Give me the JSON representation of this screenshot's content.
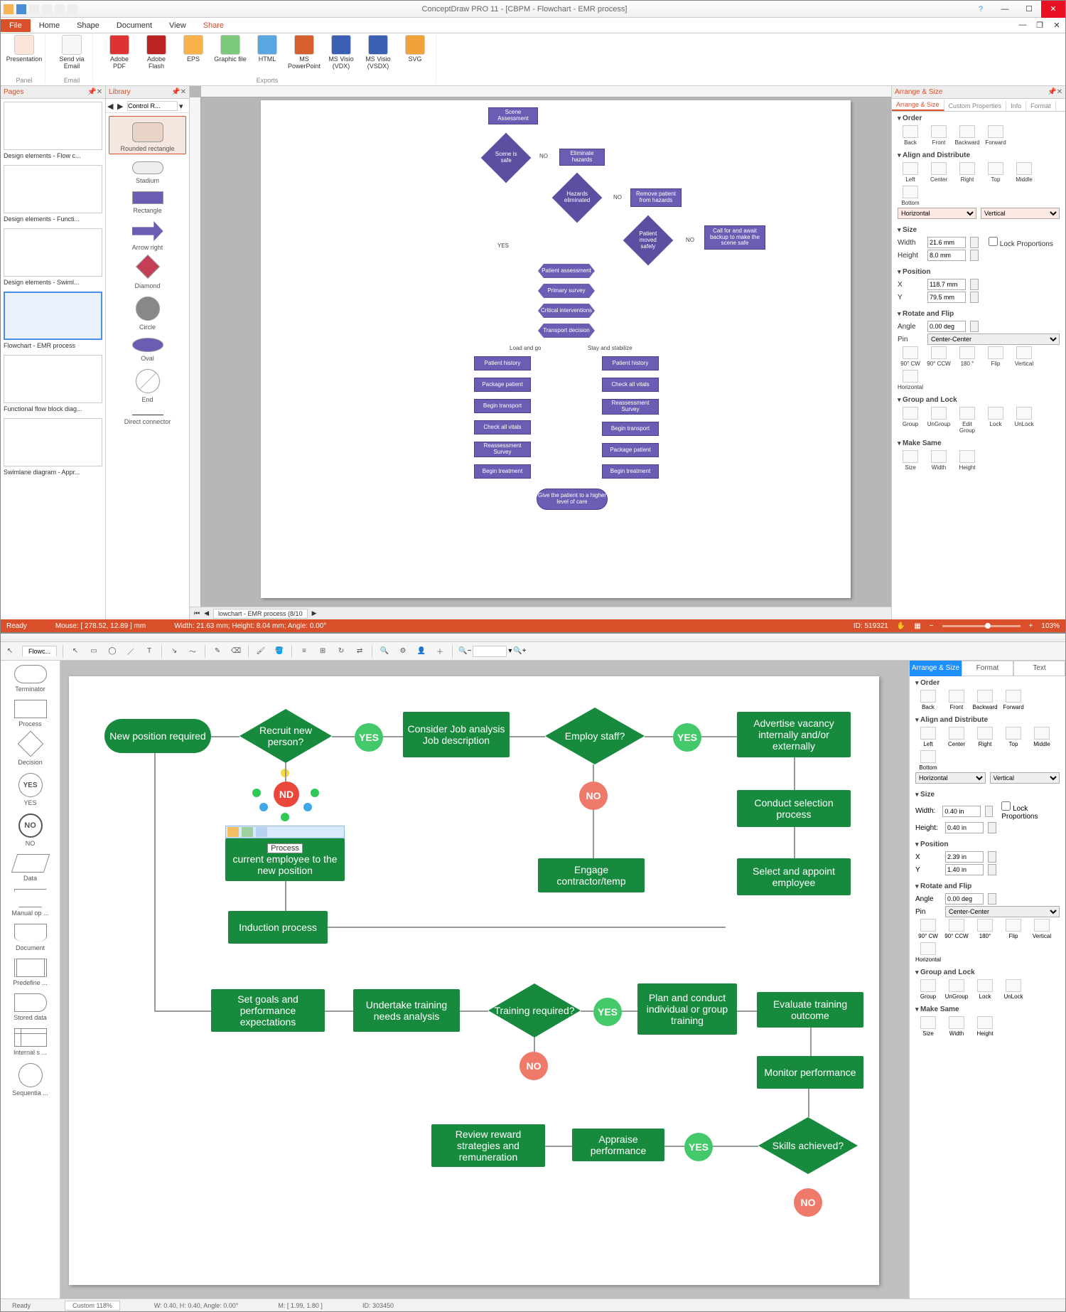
{
  "app1": {
    "title": "ConceptDraw PRO 11 - [CBPM - Flowchart - EMR process]",
    "menu": {
      "file": "File",
      "home": "Home",
      "shape": "Shape",
      "document": "Document",
      "view": "View",
      "share": "Share"
    },
    "ribbon": {
      "presentation": "Presentation",
      "sendEmail": "Send via Email",
      "adobePdf": "Adobe PDF",
      "adobeFlash": "Adobe Flash",
      "eps": "EPS",
      "graphicFile": "Graphic file",
      "html": "HTML",
      "msPpt": "MS PowerPoint",
      "visioVdx": "MS Visio (VDX)",
      "visioVsdx": "MS Visio (VSDX)",
      "svg": "SVG",
      "grpPanel": "Panel",
      "grpEmail": "Email",
      "grpExports": "Exports"
    },
    "panes": {
      "pages": "Pages",
      "library": "Library",
      "arrange": "Arrange & Size"
    },
    "pages": [
      "Design elements - Flow c...",
      "Design elements - Functi...",
      "Design elements - Swiml...",
      "Flowchart - EMR process",
      "Functional flow block diag...",
      "Swimlane diagram - Appr..."
    ],
    "libNav": "Control R...",
    "libShapes": [
      "Rounded rectangle",
      "Stadium",
      "Rectangle",
      "Arrow right",
      "Diamond",
      "Circle",
      "Oval",
      "End",
      "Direct connector"
    ],
    "flow": {
      "sceneAssessment": "Scene Assessment",
      "sceneSafe": "Scene is safe",
      "eliminateHazards": "Eliminate hazards",
      "hazardsEliminated": "Hazards eliminated",
      "removePatient": "Remove patient from hazards",
      "patientMoved": "Patient moved safely",
      "callBackup": "Call for and await backup to make the scene safe",
      "patientAssessment": "Patient assessment",
      "primarySurvey": "Primary survey",
      "criticalIntervention": "Critical interventions",
      "transportDecision": "Transport decision",
      "loadGo": "Load and go",
      "stayStab": "Stay and stabilize",
      "leftCol": [
        "Patient history",
        "Package patient",
        "Begin transport",
        "Check all vitals",
        "Reassessment Survey",
        "Begin treatment"
      ],
      "rightCol": [
        "Patient history",
        "Check all vitals",
        "Reassessment Survey",
        "Begin transport",
        "Package patient",
        "Begin treatment"
      ],
      "final": "Give the patient to a higher level of care",
      "yes": "YES",
      "no": "NO"
    },
    "tabstrip": "lowchart - EMR process (8/10",
    "rpanel": {
      "tabs": [
        "Arrange & Size",
        "Custom Properties",
        "Info",
        "Format"
      ],
      "order": "Order",
      "orderBtns": [
        "Back",
        "Front",
        "Backward",
        "Forward"
      ],
      "align": "Align and Distribute",
      "alignBtns": [
        "Left",
        "Center",
        "Right",
        "Top",
        "Middle",
        "Bottom"
      ],
      "horizontal": "Horizontal",
      "vertical": "Vertical",
      "size": "Size",
      "width": "Width",
      "widthV": "21.6 mm",
      "height": "Height",
      "heightV": "8.0 mm",
      "lock": "Lock Proportions",
      "position": "Position",
      "x": "X",
      "xV": "118.7 mm",
      "y": "Y",
      "yV": "79.5 mm",
      "rotate": "Rotate and Flip",
      "angle": "Angle",
      "angleV": "0.00 deg",
      "pin": "Pin",
      "pinV": "Center-Center",
      "rotBtns": [
        "90° CW",
        "90° CCW",
        "180 °",
        "Flip",
        "Vertical",
        "Horizontal"
      ],
      "group": "Group and Lock",
      "groupBtns": [
        "Group",
        "UnGroup",
        "Edit Group",
        "Lock",
        "UnLock"
      ],
      "makeSame": "Make Same",
      "makeSameBtns": [
        "Size",
        "Width",
        "Height"
      ]
    },
    "status": {
      "ready": "Ready",
      "mouse": "Mouse: [ 278.52, 12.89 ] mm",
      "dims": "Width: 21.63 mm;  Height: 8.04 mm;  Angle: 0.00°",
      "id": "ID: 519321",
      "zoom": "103%"
    }
  },
  "app2": {
    "tab": "Flowc...",
    "palette": [
      "Terminator",
      "Process",
      "Decision",
      "YES",
      "NO",
      "Data",
      "Manual op ...",
      "Document",
      "Predefine ...",
      "Stored data",
      "Internal s ...",
      "Sequentia ..."
    ],
    "flow": {
      "newPos": "New position required",
      "recruit": "Recruit new person?",
      "yes": "YES",
      "no": "NO",
      "nd": "ND",
      "consider": "Consider Job analysis Job description",
      "employ": "Employ staff?",
      "advertise": "Advertise vacancy internally and/or externally",
      "processLbl": "Process",
      "promote": "current employee to the new position",
      "conduct": "Conduct selection process",
      "engage": "Engage contractor/temp",
      "selectAppoint": "Select and appoint employee",
      "induction": "Induction process",
      "setGoals": "Set goals and performance expectations",
      "undertake": "Undertake training needs analysis",
      "trainReq": "Training required?",
      "plan": "Plan and conduct individual or group training",
      "evaluate": "Evaluate training outcome",
      "monitor": "Monitor performance",
      "review": "Review reward strategies and remuneration",
      "appraise": "Appraise performance",
      "skills": "Skills achieved?"
    },
    "rpanel": {
      "tabs": [
        "Arrange & Size",
        "Format",
        "Text"
      ],
      "order": "Order",
      "orderBtns": [
        "Back",
        "Front",
        "Backward",
        "Forward"
      ],
      "align": "Align and Distribute",
      "alignBtns": [
        "Left",
        "Center",
        "Right",
        "Top",
        "Middle",
        "Bottom"
      ],
      "horizontal": "Horizontal",
      "vertical": "Vertical",
      "size": "Size",
      "width": "Width:",
      "widthV": "0.40 in",
      "height": "Height:",
      "heightV": "0.40 in",
      "lock": "Lock Proportions",
      "position": "Position",
      "x": "X",
      "xV": "2.39 in",
      "y": "Y",
      "yV": "1.40 in",
      "rotate": "Rotate and Flip",
      "angle": "Angle",
      "angleV": "0.00 deg",
      "pin": "Pin",
      "pinV": "Center-Center",
      "rotBtns": [
        "90° CW",
        "90° CCW",
        "180°",
        "Flip",
        "Vertical",
        "Horizontal"
      ],
      "group": "Group and Lock",
      "groupBtns": [
        "Group",
        "UnGroup",
        "Lock",
        "UnLock"
      ],
      "makeSame": "Make Same",
      "makeSameBtns": [
        "Size",
        "Width",
        "Height"
      ]
    },
    "status": {
      "ready": "Ready",
      "zoom": "Custom 118%",
      "wh": "W: 0.40,  H: 0.40,  Angle: 0.00°",
      "m": "M: [ 1.99, 1.80 ]",
      "id": "ID: 303450"
    }
  }
}
